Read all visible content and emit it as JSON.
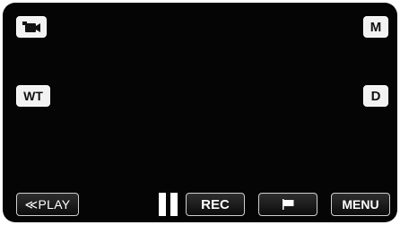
{
  "buttons": {
    "camera_mode": {
      "icon": "video-camera-icon"
    },
    "manual_mode": {
      "label": "M"
    },
    "zoom": {
      "label": "WT"
    },
    "display": {
      "label": "D"
    },
    "playback": {
      "label": "≪PLAY"
    },
    "pause": {
      "icon": "pause-icon"
    },
    "record": {
      "label": "REC"
    },
    "flag": {
      "icon": "flag-icon"
    },
    "menu": {
      "label": "MENU"
    }
  }
}
